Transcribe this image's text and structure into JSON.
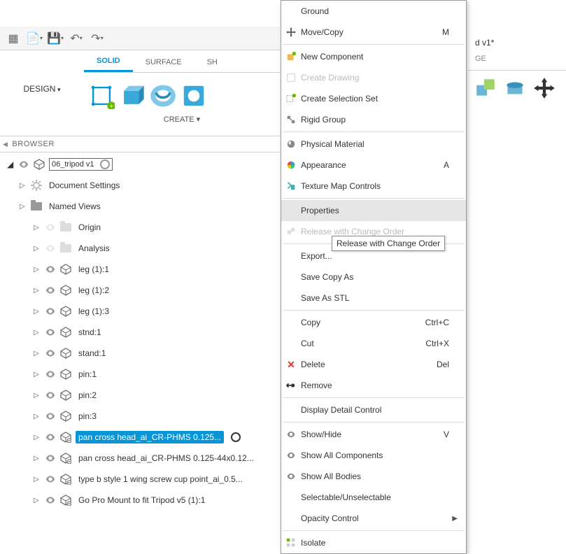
{
  "toolbar": {
    "design_label": "DESIGN"
  },
  "tabs": {
    "solid": "SOLID",
    "surface": "SURFACE",
    "sheet": "SH",
    "ge": "GE"
  },
  "create_label": "CREATE ▾",
  "topright": {
    "title": "d v1*"
  },
  "browser": {
    "header": "BROWSER",
    "root": "06_tripod v1",
    "items": [
      {
        "label": "Document Settings",
        "icon": "gear"
      },
      {
        "label": "Named Views",
        "icon": "folder"
      },
      {
        "label": "Origin",
        "icon": "folderdim",
        "indent": 2,
        "dimeye": true
      },
      {
        "label": "Analysis",
        "icon": "folderdim",
        "indent": 2,
        "dimeye": true
      },
      {
        "label": "leg (1):1",
        "icon": "comp",
        "indent": 2
      },
      {
        "label": "leg (1):2",
        "icon": "comp",
        "indent": 2
      },
      {
        "label": "leg (1):3",
        "icon": "comp",
        "indent": 2
      },
      {
        "label": "stnd:1",
        "icon": "comp",
        "indent": 2
      },
      {
        "label": "stand:1",
        "icon": "comp",
        "indent": 2
      },
      {
        "label": "pin:1",
        "icon": "comp",
        "indent": 2
      },
      {
        "label": "pin:2",
        "icon": "comp",
        "indent": 2
      },
      {
        "label": "pin:3",
        "icon": "comp",
        "indent": 2
      },
      {
        "label": "pan cross head_ai_CR-PHMS 0.125...",
        "icon": "complink",
        "indent": 2,
        "selected": true,
        "radio": true
      },
      {
        "label": "pan cross head_ai_CR-PHMS 0.125-44x0.12...",
        "icon": "complink",
        "indent": 2
      },
      {
        "label": "type b style 1 wing screw cup point_ai_0.5...",
        "icon": "complink",
        "indent": 2
      },
      {
        "label": "Go Pro Mount to fit Tripod v5 (1):1",
        "icon": "complink",
        "indent": 2
      }
    ]
  },
  "menu": {
    "ground": "Ground",
    "movecopy": "Move/Copy",
    "movecopy_sc": "M",
    "newcomp": "New Component",
    "createdrawing": "Create Drawing",
    "createselset": "Create Selection Set",
    "rigidgroup": "Rigid Group",
    "physmat": "Physical Material",
    "appearance": "Appearance",
    "appearance_sc": "A",
    "texmap": "Texture Map Controls",
    "properties": "Properties",
    "release": "Release with Change Order",
    "export": "Export...",
    "savecopy": "Save Copy As",
    "savestl": "Save As STL",
    "copy": "Copy",
    "copy_sc": "Ctrl+C",
    "cut": "Cut",
    "cut_sc": "Ctrl+X",
    "delete": "Delete",
    "delete_sc": "Del",
    "remove": "Remove",
    "ddc": "Display Detail Control",
    "showhide": "Show/Hide",
    "showhide_sc": "V",
    "showallcomp": "Show All Components",
    "showallbodies": "Show All Bodies",
    "selunsel": "Selectable/Unselectable",
    "opacity": "Opacity Control",
    "isolate": "Isolate"
  },
  "tooltip": "Release with Change Order"
}
